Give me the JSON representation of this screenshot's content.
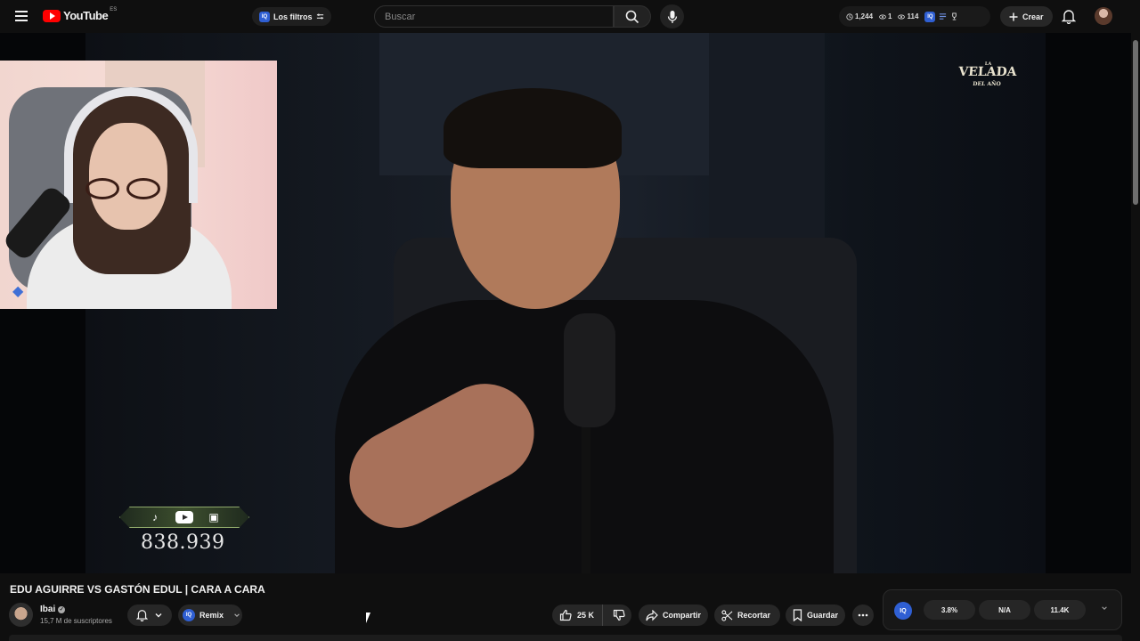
{
  "header": {
    "logo_text": "YouTube",
    "logo_country": "ES",
    "filters_label": "Los filtros",
    "search_placeholder": "Buscar",
    "stats": {
      "views": "1,244",
      "watching": "1",
      "other": "114"
    },
    "create_label": "Crear"
  },
  "video": {
    "overlay_brand": {
      "top": "LA",
      "main": "VELADA",
      "sub": "DEL AÑO"
    },
    "counter_value": "838.939",
    "counter_icons": [
      "tiktok-icon",
      "youtube-icon",
      "twitch-icon"
    ]
  },
  "details": {
    "title": "EDU AGUIRRE VS GASTÓN EDUL | CARA A CARA",
    "channel_name": "Ibai",
    "subscribers": "15,7 M de suscriptores",
    "remix_label": "Remix",
    "likes": "25 K",
    "share_label": "Compartir",
    "clip_label": "Recortar",
    "save_label": "Guardar"
  },
  "extension": {
    "badge": "IQ",
    "metrics": [
      "3.8%",
      "N/A",
      "11.4K"
    ]
  },
  "colors": {
    "background": "#0f0f0f",
    "chip": "#272727",
    "accent_red": "#ff0000",
    "iq_blue": "#2f5fd3"
  }
}
